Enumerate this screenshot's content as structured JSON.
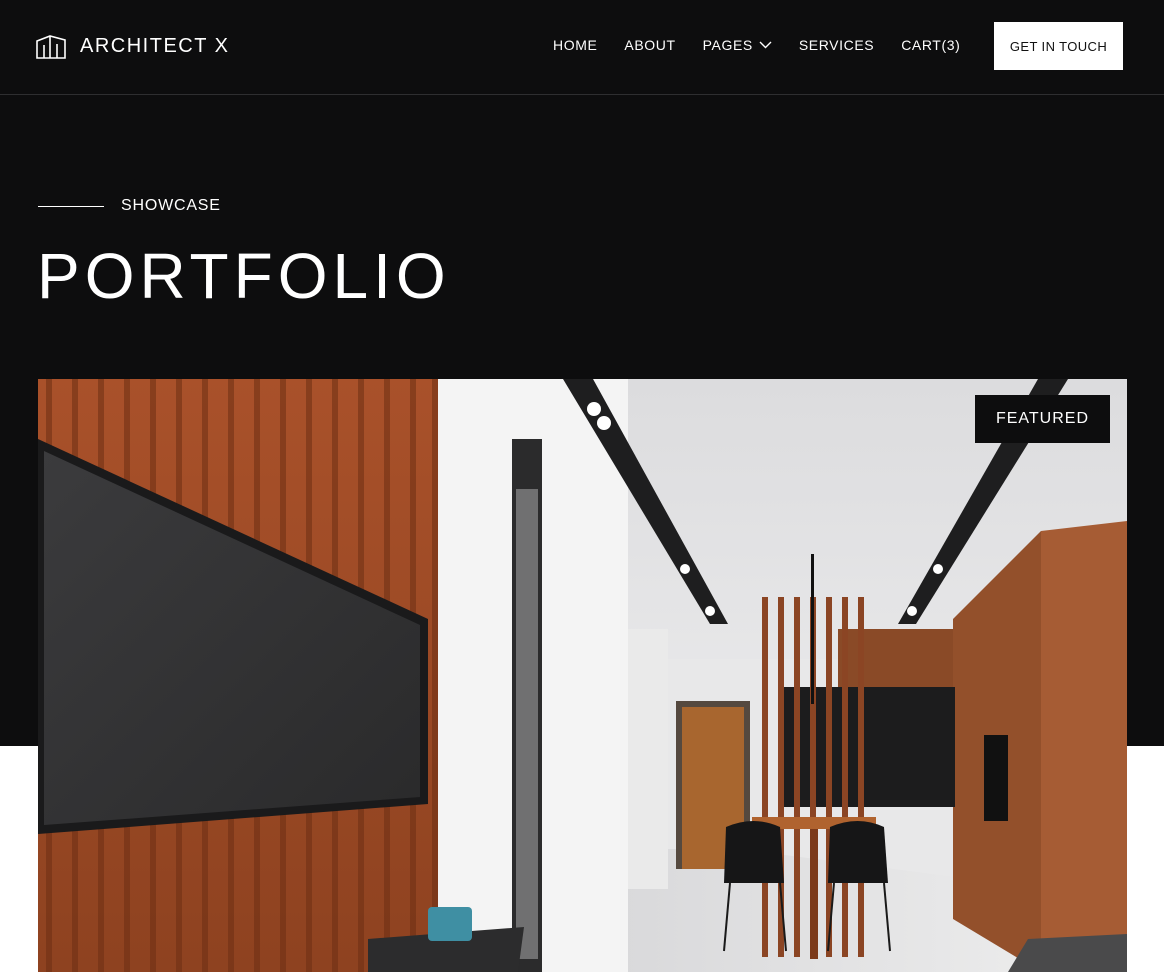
{
  "brand": {
    "name": "ARCHITECT X",
    "logo_icon": "building-icon"
  },
  "nav": {
    "items": [
      {
        "label": "HOME"
      },
      {
        "label": "ABOUT"
      },
      {
        "label": "PAGES",
        "icon": "chevron-down-icon"
      },
      {
        "label": "SERVICES"
      },
      {
        "label": "CART(3)"
      }
    ],
    "cta_label": "GET IN TOUCH"
  },
  "hero": {
    "eyebrow": "SHOWCASE",
    "title": "PORTFOLIO",
    "badge": "FEATURED"
  },
  "colors": {
    "background_dark": "#0d0d0e",
    "accent_wood": "#b35a2b",
    "text_light": "#ffffff"
  }
}
